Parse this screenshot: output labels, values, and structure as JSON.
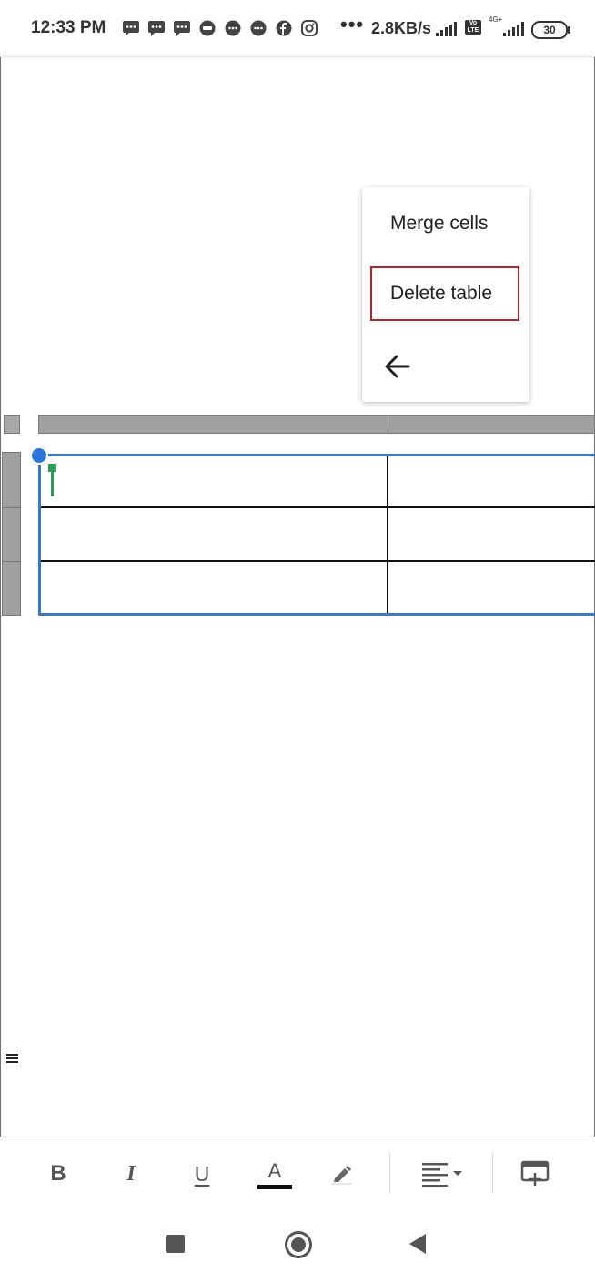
{
  "status_bar": {
    "time": "12:33 PM",
    "overflow_dots": "•••",
    "network_speed": "2.8KB/s",
    "volte_label": "Vo LTE",
    "network_type": "4G+",
    "battery_level": "30",
    "notification_icons": [
      "message-icon",
      "message-icon",
      "message-icon",
      "jio-icon",
      "chat-bubble-icon",
      "chat-bubble-icon",
      "facebook-icon",
      "instagram-icon"
    ]
  },
  "context_menu": {
    "items": [
      {
        "label": "Merge cells"
      },
      {
        "label": "Delete table",
        "highlighted": true
      }
    ],
    "back_icon": "arrow-left-icon"
  },
  "table": {
    "rows": 3,
    "columns": 2,
    "cells": [
      [
        "",
        ""
      ],
      [
        "",
        ""
      ],
      [
        "",
        ""
      ]
    ],
    "selection_color": "#3b78c1"
  },
  "toolbar": {
    "bold_label": "B",
    "italic_label": "I",
    "underline_label": "U",
    "text_color_label": "A",
    "icons": [
      "bold-icon",
      "italic-icon",
      "underline-icon",
      "text-color-icon",
      "highlight-pen-icon",
      "align-left-icon",
      "insert-table-row-icon"
    ]
  },
  "nav_bar": {
    "icons": [
      "recents-square-icon",
      "home-circle-icon",
      "back-triangle-icon"
    ]
  },
  "colors": {
    "highlight_border": "#b3262d",
    "handle_blue": "#2b74d8",
    "cursor_green": "#2e9a57"
  }
}
